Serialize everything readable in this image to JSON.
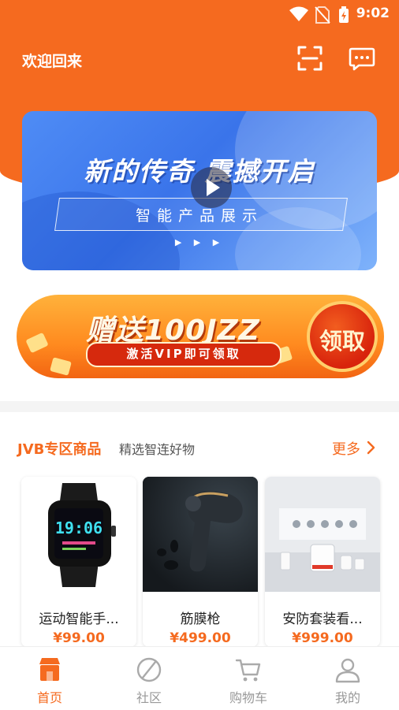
{
  "statusbar": {
    "time": "9:02",
    "icons": [
      "wifi-icon",
      "no-sim-icon",
      "battery-charging-icon"
    ]
  },
  "header": {
    "title": "欢迎回来",
    "icons": [
      "scan-icon",
      "message-icon"
    ]
  },
  "banner": {
    "headline": "新的传奇 震撼开启",
    "subtitle": "智能产品展示",
    "indicator": "▶ ▶ ▶",
    "play_icon": "play-icon"
  },
  "promo": {
    "title": "赠送100JZZ",
    "subtitle": "激活VIP即可领取",
    "claim_label": "领取"
  },
  "section": {
    "title": "JVB专区商品",
    "subtitle": "精选智连好物",
    "more_label": "更多"
  },
  "products": [
    {
      "name": "运动智能手...",
      "price": "¥99.00",
      "image": "smartwatch"
    },
    {
      "name": "筋膜枪",
      "price": "¥499.00",
      "image": "massage-gun"
    },
    {
      "name": "安防套装看...",
      "price": "¥999.00",
      "image": "security-kit"
    }
  ],
  "tabbar": {
    "active_index": 0,
    "items": [
      {
        "label": "首页",
        "icon": "home-shop-icon"
      },
      {
        "label": "社区",
        "icon": "community-icon"
      },
      {
        "label": "购物车",
        "icon": "cart-icon"
      },
      {
        "label": "我的",
        "icon": "profile-icon"
      }
    ]
  },
  "colors": {
    "primary": "#f56a1f",
    "banner_blue": "#3a74ea",
    "promo_red": "#d6290d"
  }
}
